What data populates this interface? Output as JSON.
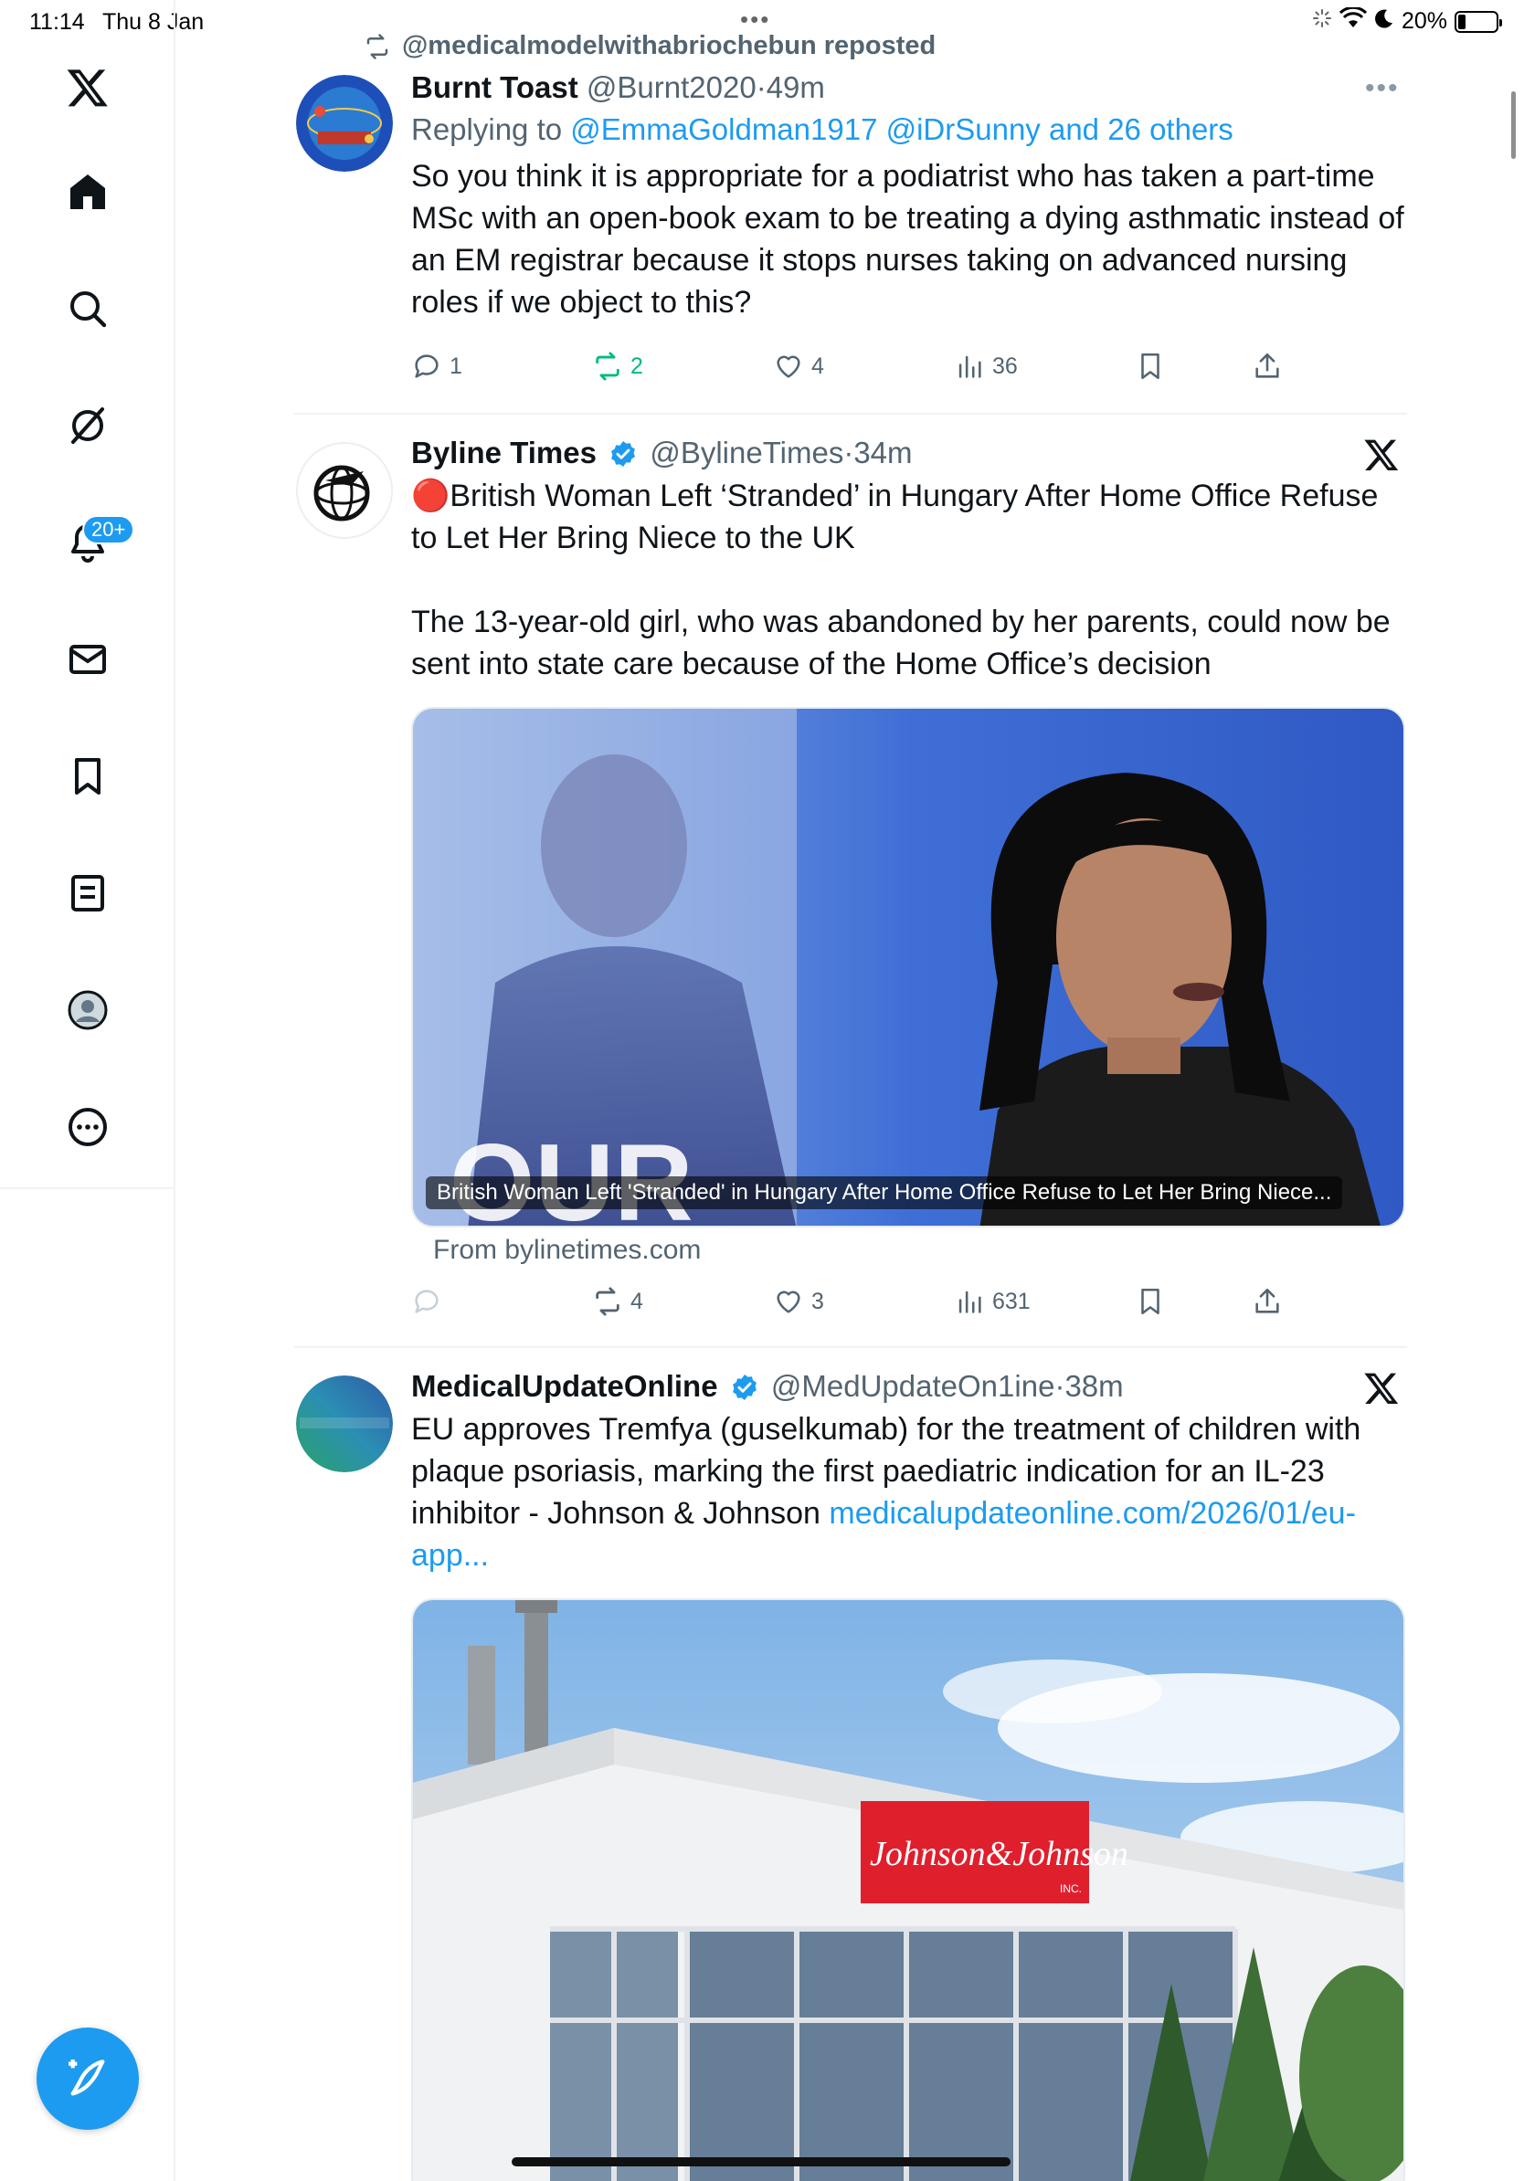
{
  "status_bar": {
    "time": "11:14",
    "date": "Thu 8 Jan",
    "battery": "20%",
    "battery_level": 0.2
  },
  "sidebar": {
    "items": [
      {
        "icon": "x-logo-icon"
      },
      {
        "icon": "home-icon"
      },
      {
        "icon": "search-icon"
      },
      {
        "icon": "grok-icon"
      },
      {
        "icon": "notifications-icon",
        "badge": "20+"
      },
      {
        "icon": "messages-icon"
      },
      {
        "icon": "bookmarks-icon"
      },
      {
        "icon": "lists-icon"
      },
      {
        "icon": "profile-icon"
      },
      {
        "icon": "more-icon"
      }
    ],
    "compose": "compose-post-icon"
  },
  "colors": {
    "accent": "#1d9bf0",
    "retweet_green": "#00ba7c",
    "secondary_text": "#536471"
  },
  "feed": {
    "tweets": [
      {
        "repost_banner": "@medicalmodelwithabriochebun reposted",
        "name": "Burnt Toast",
        "handle": "@Burnt2020",
        "sep": "·",
        "time": "49m",
        "reply_prefix": "Replying to ",
        "reply_to": "@EmmaGoldman1917 @iDrSunny and 26 others",
        "text": "So you think it is appropriate for a podiatrist who has taken a part-time MSc with an open-book exam to be treating a dying asthmatic instead of an EM registrar because it stops nurses taking on advanced nursing roles if we object to this?",
        "replies": "1",
        "reposts": "2",
        "likes": "4",
        "views": "36"
      },
      {
        "name": "Byline Times",
        "handle": "@BylineTimes",
        "sep": "·",
        "time": "34m",
        "text_1": "🔴British Woman Left ‘Stranded’ in Hungary After Home Office Refuse to Let Her Bring Niece to the UK",
        "text_2": "The 13-year-old girl, who was abandoned by her parents, could now be sent into state care because of the Home Office’s decision",
        "card_caption": "British Woman Left 'Stranded' in Hungary After Home Office Refuse to Let Her Bring Niece...",
        "card_from": "From bylinetimes.com",
        "replies": "",
        "reposts": "4",
        "likes": "3",
        "views": "631"
      },
      {
        "name": "MedicalUpdateOnline",
        "handle": "@MedUpdateOn1ine",
        "sep": "·",
        "time": "38m",
        "text": "EU approves Tremfya (guselkumab) for the treatment of children with plaque psoriasis, marking the first paediatric indication for an IL-23 inhibitor - Johnson & Johnson ",
        "link": "medicalupdateonline.com/2026/01/eu-app..."
      }
    ]
  }
}
